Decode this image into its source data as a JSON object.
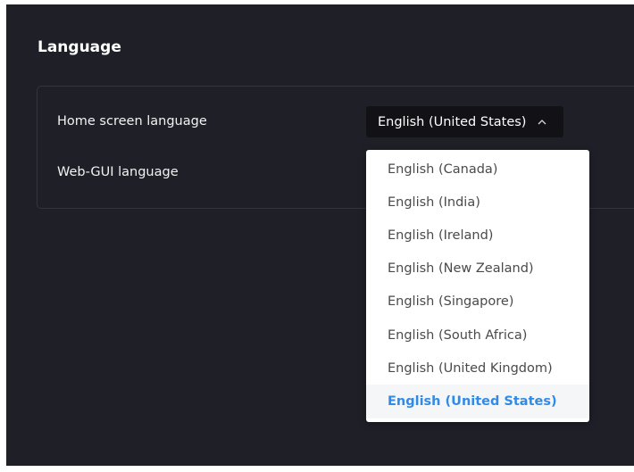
{
  "section": {
    "title": "Language"
  },
  "settings": {
    "home_screen_label": "Home screen language",
    "web_gui_label": "Web-GUI language"
  },
  "home_select": {
    "value": "English (United States)",
    "icon": "chevron-up-icon",
    "expanded": true
  },
  "dropdown": {
    "options": [
      {
        "label": "English (Canada)"
      },
      {
        "label": "English (India)"
      },
      {
        "label": "English (Ireland)"
      },
      {
        "label": "English (New Zealand)"
      },
      {
        "label": "English (Singapore)"
      },
      {
        "label": "English (South Africa)"
      },
      {
        "label": "English (United Kingdom)"
      },
      {
        "label": "English (United States)"
      }
    ],
    "selected_index": 7
  },
  "colors": {
    "background": "#1f1f28",
    "select_background": "#111116",
    "dropdown_background": "#ffffff",
    "selected_text": "#2f8bea",
    "option_text": "#4a4a4a"
  }
}
